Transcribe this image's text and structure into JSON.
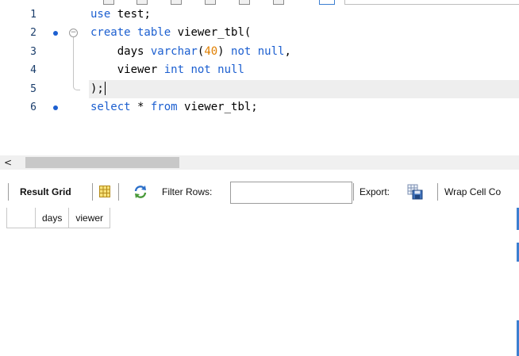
{
  "editor": {
    "lines": [
      {
        "number": "1",
        "breakpoint": false,
        "tokens": [
          {
            "t": "use",
            "k": "kw"
          },
          {
            "t": " test;",
            "k": "plain"
          }
        ]
      },
      {
        "number": "2",
        "breakpoint": true,
        "fold": "⊖",
        "tokens": [
          {
            "t": "create table",
            "k": "kw"
          },
          {
            "t": " viewer_tbl(",
            "k": "plain"
          }
        ]
      },
      {
        "number": "3",
        "breakpoint": false,
        "tokens": [
          {
            "t": "    days ",
            "k": "plain"
          },
          {
            "t": "varchar",
            "k": "kw"
          },
          {
            "t": "(",
            "k": "plain"
          },
          {
            "t": "40",
            "k": "num"
          },
          {
            "t": ") ",
            "k": "plain"
          },
          {
            "t": "not null",
            "k": "kw"
          },
          {
            "t": ",",
            "k": "plain"
          }
        ]
      },
      {
        "number": "4",
        "breakpoint": false,
        "tokens": [
          {
            "t": "    viewer ",
            "k": "plain"
          },
          {
            "t": "int",
            "k": "kw"
          },
          {
            "t": " ",
            "k": "plain"
          },
          {
            "t": "not null",
            "k": "kw"
          }
        ]
      },
      {
        "number": "5",
        "breakpoint": false,
        "current": true,
        "tokens": [
          {
            "t": ");",
            "k": "plain"
          }
        ]
      },
      {
        "number": "6",
        "breakpoint": true,
        "tokens": [
          {
            "t": "select",
            "k": "kw"
          },
          {
            "t": " * ",
            "k": "plain"
          },
          {
            "t": "from",
            "k": "kw"
          },
          {
            "t": " viewer_tbl;",
            "k": "plain"
          }
        ]
      }
    ]
  },
  "scrollbar": {
    "left_arrow": "<"
  },
  "result_toolbar": {
    "result_grid_label": "Result Grid",
    "filter_rows_label": "Filter Rows:",
    "filter_rows_value": "",
    "export_label": "Export:",
    "wrap_label": "Wrap Cell Co"
  },
  "grid": {
    "columns": [
      "days",
      "viewer"
    ]
  },
  "icons": {
    "grid": "grid-icon",
    "refresh": "refresh-icon",
    "export": "export-icon"
  },
  "colors": {
    "keyword": "#1c5fd0",
    "number": "#e07f00",
    "breakpoint": "#1c5fd0",
    "current_line": "#eeeeee"
  }
}
